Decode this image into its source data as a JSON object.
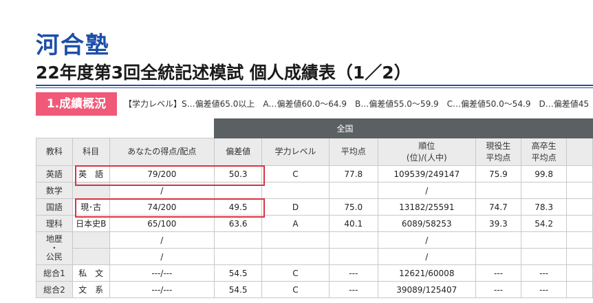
{
  "header": {
    "logo_text": "河合塾",
    "title": "22年度第3回全統記述模試 個人成績表（1／2）"
  },
  "section": {
    "badge": "1.成績概況",
    "legend": "【学力レベル】S…偏差値65.0以上　A…偏差値60.0〜64.9　B…偏差値55.0〜59.9　C…偏差値50.0〜54.9　D…偏差値45"
  },
  "table": {
    "group_header": "全国",
    "columns": {
      "kyouka": "教科",
      "kamoku": "科目",
      "score": "あなたの得点/配点",
      "hensachi": "偏差値",
      "level": "学力レベル",
      "avg": "平均点",
      "rank_line1": "順位",
      "rank_line2": "(位)/(人中)",
      "geneki_line1": "現役生",
      "geneki_line2": "平均点",
      "kousotsu_line1": "高卒生",
      "kousotsu_line2": "平均点"
    },
    "rows": [
      {
        "kyouka": "英語",
        "kamoku": "英　語",
        "score": "79/200",
        "hensachi": "50.3",
        "level": "C",
        "avg": "77.8",
        "rank": "109539/249147",
        "geneki": "75.9",
        "kousotsu": "99.8"
      },
      {
        "kyouka": "数学",
        "kamoku": "",
        "score": "/",
        "hensachi": "",
        "level": "",
        "avg": "",
        "rank": "/",
        "geneki": "",
        "kousotsu": ""
      },
      {
        "kyouka": "国語",
        "kamoku": "現･古",
        "score": "74/200",
        "hensachi": "49.5",
        "level": "D",
        "avg": "75.0",
        "rank": "13182/25591",
        "geneki": "74.7",
        "kousotsu": "78.3"
      },
      {
        "kyouka": "理科",
        "kamoku": "日本史B",
        "score": "65/100",
        "hensachi": "63.6",
        "level": "A",
        "avg": "40.1",
        "rank": "6089/58253",
        "geneki": "39.3",
        "kousotsu": "54.2"
      },
      {
        "kyouka": "",
        "kamoku": "",
        "score": "/",
        "hensachi": "",
        "level": "",
        "avg": "",
        "rank": "/",
        "geneki": "",
        "kousotsu": ""
      },
      {
        "kyouka": "",
        "kamoku": "",
        "score": "/",
        "hensachi": "",
        "level": "",
        "avg": "",
        "rank": "/",
        "geneki": "",
        "kousotsu": ""
      },
      {
        "kyouka": "総合1",
        "kamoku": "私　文",
        "score": "---/---",
        "hensachi": "54.5",
        "level": "C",
        "avg": "---",
        "rank": "12621/60008",
        "geneki": "---",
        "kousotsu": "---"
      },
      {
        "kyouka": "総合2",
        "kamoku": "文　系",
        "score": "---/---",
        "hensachi": "54.5",
        "level": "C",
        "avg": "---",
        "rank": "39089/125407",
        "geneki": "---",
        "kousotsu": "---"
      }
    ],
    "merged_kyouka": {
      "line1": "地歴",
      "dot": "・",
      "line2": "公民"
    }
  },
  "colors": {
    "logo": "#1d4fa8",
    "badge": "#f05a78",
    "header_dark": "#5b6163",
    "highlight": "#d8333f"
  }
}
